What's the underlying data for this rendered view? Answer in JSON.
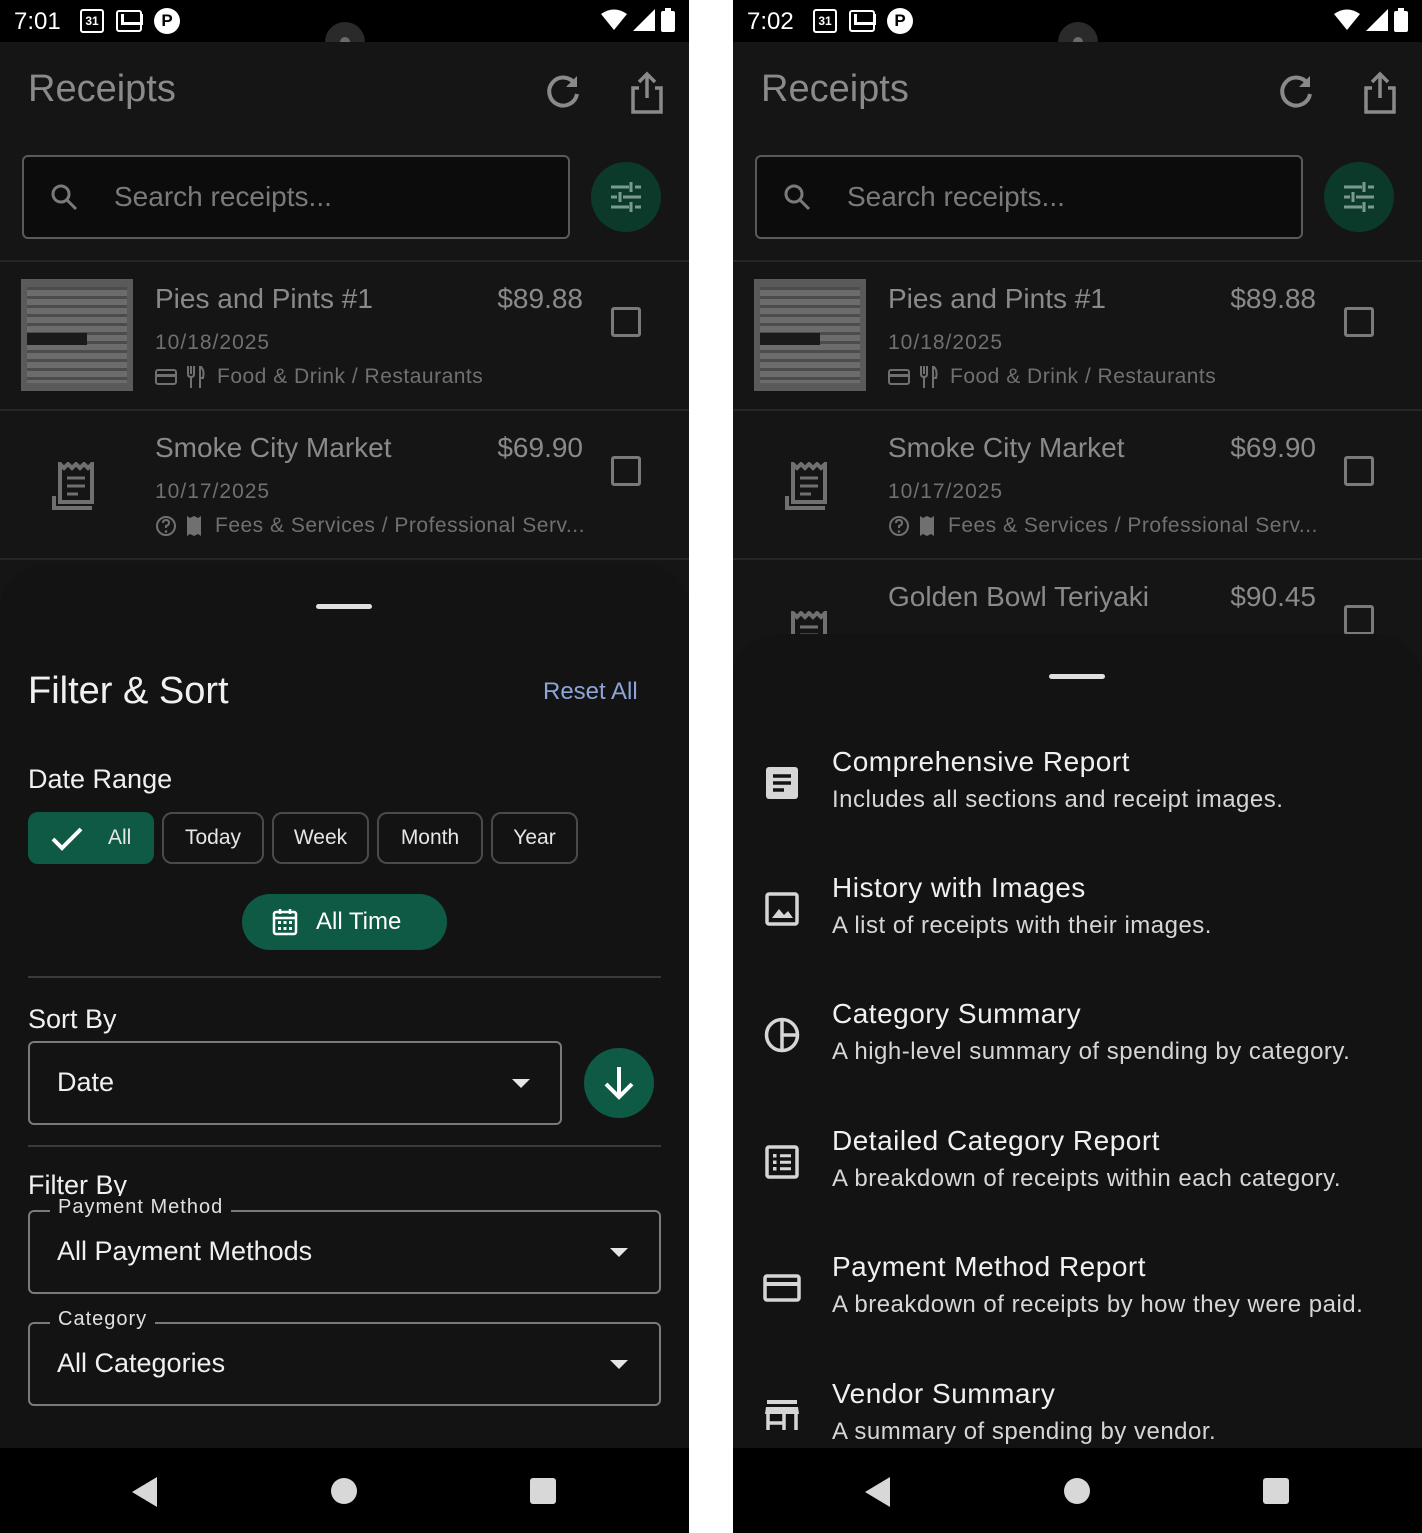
{
  "colors": {
    "accent": "#0e5a45",
    "accent_dim": "#0c3a2a",
    "link": "#8ea3d6",
    "sheet_bg": "#131313"
  },
  "left": {
    "status": {
      "time": "7:01",
      "calendar_day": "31"
    },
    "appbar": {
      "title": "Receipts"
    },
    "search": {
      "placeholder": "Search receipts..."
    },
    "receipts": [
      {
        "vendor": "Pies and Pints #1",
        "amount": "$89.88",
        "date": "10/18/2025",
        "category": "Food & Drink / Restaurants",
        "payment_icon": "card-icon",
        "category_icon": "fork-knife-icon"
      },
      {
        "vendor": "Smoke City Market",
        "amount": "$69.90",
        "date": "10/17/2025",
        "category": "Fees & Services / Professional Serv...",
        "payment_icon": "help-circle-icon",
        "category_icon": "receipt-icon"
      }
    ],
    "sheet": {
      "title": "Filter & Sort",
      "reset": "Reset All",
      "date_range": {
        "label": "Date Range",
        "chips": [
          "All",
          "Today",
          "Week",
          "Month",
          "Year"
        ],
        "selected": "All",
        "custom_button": "All Time"
      },
      "sort": {
        "label": "Sort By",
        "value": "Date"
      },
      "filter": {
        "label": "Filter By",
        "payment": {
          "legend": "Payment Method",
          "value": "All Payment Methods"
        },
        "category": {
          "legend": "Category",
          "value": "All Categories"
        }
      }
    }
  },
  "right": {
    "status": {
      "time": "7:02",
      "calendar_day": "31"
    },
    "appbar": {
      "title": "Receipts"
    },
    "search": {
      "placeholder": "Search receipts..."
    },
    "receipts": [
      {
        "vendor": "Pies and Pints #1",
        "amount": "$89.88",
        "date": "10/18/2025",
        "category": "Food & Drink / Restaurants"
      },
      {
        "vendor": "Smoke City Market",
        "amount": "$69.90",
        "date": "10/17/2025",
        "category": "Fees & Services / Professional Serv..."
      },
      {
        "vendor": "Golden Bowl Teriyaki",
        "amount": "$90.45"
      }
    ],
    "export_options": [
      {
        "title": "Comprehensive Report",
        "desc": "Includes all sections and receipt images.",
        "icon": "document-icon"
      },
      {
        "title": "History with Images",
        "desc": "A list of receipts with their images.",
        "icon": "image-icon"
      },
      {
        "title": "Category Summary",
        "desc": "A high-level summary of spending by category.",
        "icon": "pie-chart-icon"
      },
      {
        "title": "Detailed Category Report",
        "desc": "A breakdown of receipts within each category.",
        "icon": "list-icon"
      },
      {
        "title": "Payment Method Report",
        "desc": "A breakdown of receipts by how they were paid.",
        "icon": "credit-card-icon"
      },
      {
        "title": "Vendor Summary",
        "desc": "A summary of spending by vendor.",
        "icon": "store-icon"
      }
    ]
  }
}
